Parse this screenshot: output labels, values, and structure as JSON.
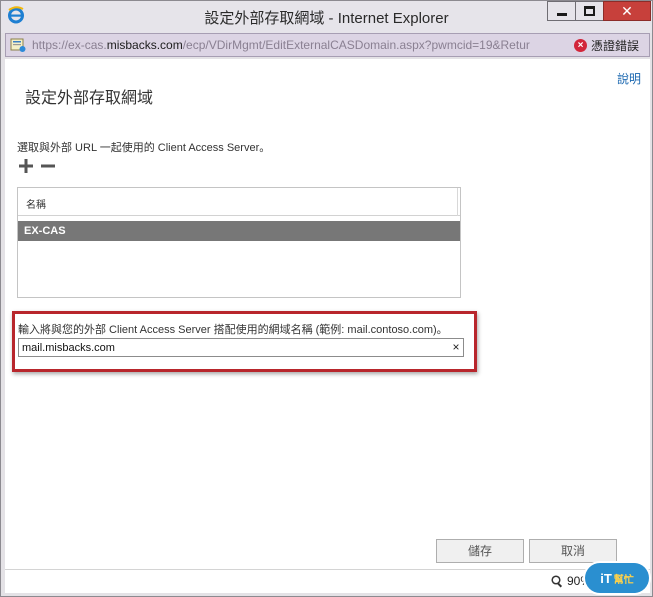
{
  "window": {
    "title": "設定外部存取網域 - Internet Explorer",
    "close_symbol": "✕"
  },
  "address_bar": {
    "url_prefix": "https://ex-cas.",
    "url_host": "misbacks.com",
    "url_path": "/ecp/VDirMgmt/EditExternalCASDomain.aspx?pwmcid=19&Retur",
    "certificate_error": "憑證錯誤",
    "certificate_icon": "x-circle-icon"
  },
  "page": {
    "help_link": "說明",
    "title": "設定外部存取網域",
    "select_label": "選取與外部 URL 一起使用的 Client Access Server。",
    "list": {
      "column_header": "名稱",
      "rows": [
        "EX-CAS"
      ]
    },
    "domain_label": "輸入將與您的外部 Client Access Server 搭配使用的網域名稱 (範例: mail.contoso.com)。",
    "domain_value": "mail.misbacks.com",
    "clear_symbol": "×",
    "save_button": "儲存",
    "cancel_button": "取消"
  },
  "status_bar": {
    "zoom": "90%"
  },
  "watermark": {
    "text": "iT",
    "sub": "幫忙"
  },
  "colors": {
    "highlight_border": "#b8262c",
    "selected_row": "#777777",
    "link": "#1a67b0",
    "close_button": "#c7403b"
  }
}
